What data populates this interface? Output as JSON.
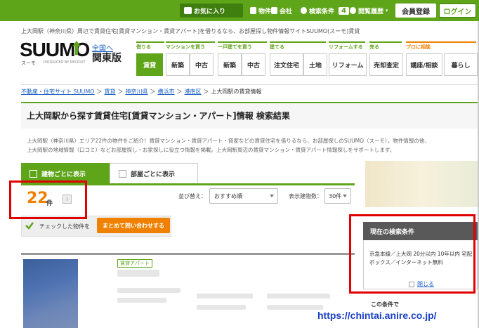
{
  "top_nav": {
    "favorites": "お気に入り",
    "properties": "物件",
    "companies": "会社",
    "search_saved": "検索条件",
    "search_saved_count": "4",
    "history": "閲覧履歴",
    "member_register": "会員登録",
    "login": "ログイン"
  },
  "tagline": "上大岡駅（神奈川県）周辺で賃貸住宅[賃貸マンション・賃貸アパート]を借りるなら、お部屋探し物件情報サイトSUUMO(スーモ)賃貸",
  "logo": {
    "text": "SUUMO",
    "sub": "スーモ",
    "recruit": "PRODUCED BY RECRUIT",
    "region_link": "全国へ",
    "region": "関東版"
  },
  "categories": [
    {
      "label": "借りる"
    },
    {
      "label": "マンションを買う"
    },
    {
      "label": "一戸建てを買う"
    },
    {
      "label": "建てる"
    },
    {
      "label": "リフォームする"
    },
    {
      "label": "売る"
    },
    {
      "label": "プロに相談"
    }
  ],
  "nav_buttons": [
    "賃貸",
    "新築",
    "中古",
    "新築",
    "中古",
    "注文住宅",
    "土地",
    "リフォーム",
    "売却査定",
    "講座/相談",
    "暮らし"
  ],
  "breadcrumb": [
    "不動産・住宅サイト SUUMO",
    "賃貸",
    "神奈川県",
    "横浜市",
    "港南区",
    "上大岡駅の賃貸情報"
  ],
  "page_title": "上大岡駅から探す賃貸住宅[賃貸マンション・アパート]情報 検索結果",
  "description": [
    "上大岡駅（神奈川県）エリア22件の物件をご紹介！賃貸マンション・賃貸アパート・貸家などの賃貸住宅を借りるなら、お部屋探しのSUUMO（スーモ）。物件情報の他、",
    "上大岡駅の地域情報（口コミ）などお部屋探し・お家探しに役立つ情報を掲載。上大岡駅周辺の賃貸マンション・賃貸アパート情報探しをサポートします。"
  ],
  "tabs": {
    "by_building": "建物ごとに表示",
    "by_room": "部屋ごとに表示"
  },
  "results": {
    "count": "22",
    "unit": "件",
    "info_icon": "i"
  },
  "sort": {
    "label": "並び替え：",
    "value": "おすすめ順",
    "display_label": "表示建物数：",
    "display_value": "30件"
  },
  "inquiry": {
    "text": "チェックした物件を",
    "button": "まとめて問い合わせする"
  },
  "listing": {
    "type": "賃貸アパート"
  },
  "conditions": {
    "heading": "現在の検索条件",
    "body": "京急本線／上大岡 20分以内 10年以内 宅配ボックス／インターネット無料",
    "close": "閉じる",
    "other": "この条件で"
  },
  "watermark": "https://chintai.anire.co.jp/",
  "colors": {
    "brand_green": "#5fa51a",
    "accent_orange": "#f08000",
    "highlight_red": "#e00000"
  }
}
